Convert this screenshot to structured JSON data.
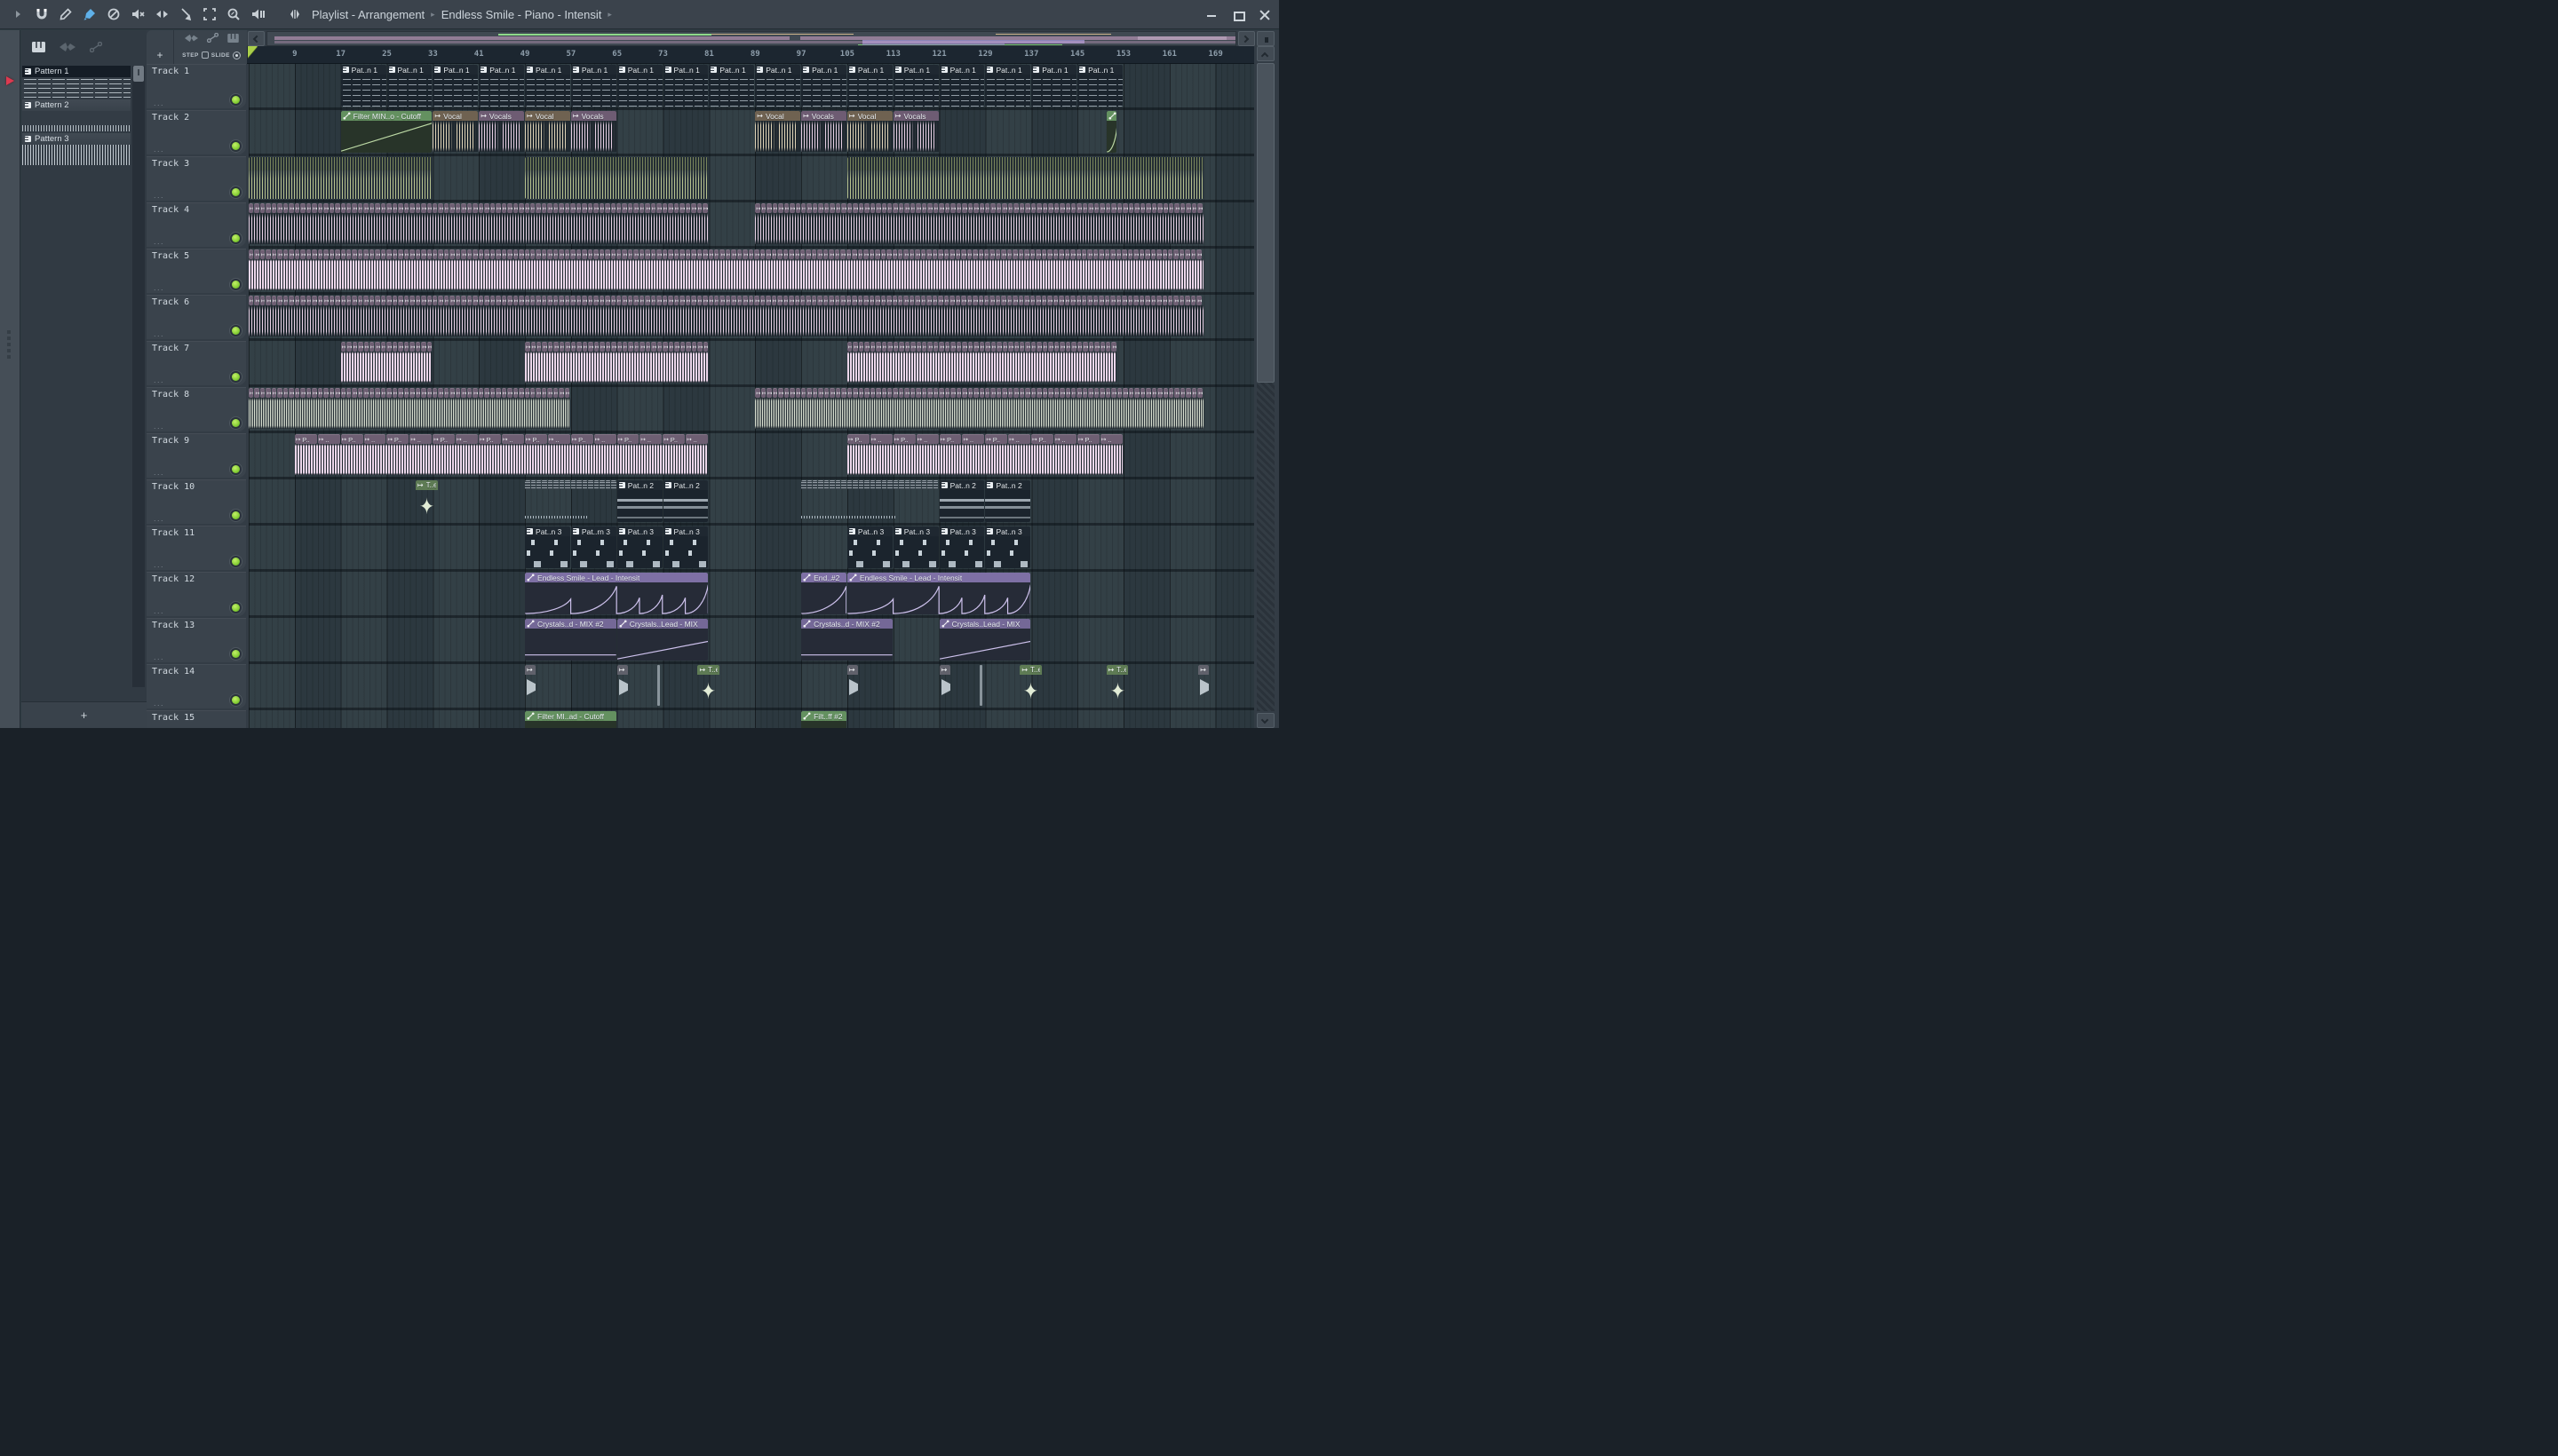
{
  "window": {
    "title_left": "Playlist - Arrangement",
    "title_right": "Endless Smile - Piano - Intensit",
    "chevron": "▸"
  },
  "toolbar_icons": [
    "play",
    "magnet",
    "pencil",
    "brush",
    "deny",
    "mute",
    "stretch",
    "slip",
    "select",
    "zoom",
    "preview-speaker"
  ],
  "window_controls": [
    "minimize",
    "maximize",
    "close"
  ],
  "picker": {
    "filter_icons": [
      "piano",
      "audio",
      "automation"
    ],
    "patterns": [
      {
        "name": "Pattern 1",
        "selected": true,
        "preview": "melody"
      },
      {
        "name": "Pattern 2",
        "selected": false,
        "preview": "dense"
      },
      {
        "name": "Pattern 3",
        "selected": false,
        "preview": "blocks"
      }
    ],
    "add_button": "+"
  },
  "playlist": {
    "add_track": "+",
    "step": "STEP",
    "slide": "SLIDE",
    "bar_width": 6.48,
    "ruler": [
      9,
      17,
      25,
      33,
      41,
      49,
      57,
      65,
      73,
      81,
      89,
      97,
      105,
      113,
      121,
      129,
      137,
      145,
      153,
      161,
      169
    ],
    "tracks": [
      {
        "name": "Track 1",
        "menu_dots": "...",
        "clips": [
          {
            "t": "pat",
            "l": "Pat..n 1",
            "s": 17,
            "e": 153,
            "rep": 8,
            "body": "notes"
          }
        ]
      },
      {
        "name": "Track 2",
        "menu_dots": "...",
        "clips": [
          {
            "t": "auto",
            "l": "Filter MIN..o - Cutoff",
            "s": 17,
            "e": 33,
            "c": "green",
            "body": "ramp"
          },
          {
            "t": "audio",
            "l": "Vocal",
            "s": 33,
            "e": 41,
            "c": "tan",
            "wave": "cream"
          },
          {
            "t": "audio",
            "l": "Vocals",
            "s": 41,
            "e": 49,
            "c": "plum",
            "wave": "pink"
          },
          {
            "t": "audio",
            "l": "Vocal",
            "s": 49,
            "e": 57,
            "c": "tan",
            "wave": "cream"
          },
          {
            "t": "audio",
            "l": "Vocals",
            "s": 57,
            "e": 65,
            "c": "plum",
            "wave": "pink"
          },
          {
            "t": "audio",
            "l": "Vocal",
            "s": 89,
            "e": 97,
            "c": "tan",
            "wave": "cream"
          },
          {
            "t": "audio",
            "l": "Vocals",
            "s": 97,
            "e": 105,
            "c": "plum",
            "wave": "pink"
          },
          {
            "t": "audio",
            "l": "Vocal",
            "s": 105,
            "e": 113,
            "c": "tan",
            "wave": "cream"
          },
          {
            "t": "audio",
            "l": "Vocals",
            "s": 113,
            "e": 121,
            "c": "plum",
            "wave": "pink"
          },
          {
            "t": "auto",
            "l": "",
            "s": 150,
            "e": 152,
            "c": "green",
            "body": "rise"
          }
        ]
      },
      {
        "name": "Track 3",
        "menu_dots": "...",
        "clips": [
          {
            "t": "stripes",
            "s": 1,
            "e": 33
          },
          {
            "t": "stripes",
            "s": 49,
            "e": 81
          },
          {
            "t": "stripes",
            "s": 105,
            "e": 137
          },
          {
            "t": "stripes",
            "s": 137,
            "e": 167
          }
        ]
      },
      {
        "name": "Track 4",
        "menu_dots": "...",
        "clips": [
          {
            "t": "units",
            "s": 1,
            "e": 81,
            "u": 1,
            "wave": "pinku"
          },
          {
            "t": "units",
            "s": 89,
            "e": 167,
            "u": 1,
            "wave": "pinku"
          }
        ]
      },
      {
        "name": "Track 5",
        "menu_dots": "...",
        "clips": [
          {
            "t": "units",
            "s": 1,
            "e": 167,
            "u": 1,
            "wave": "pinkfat"
          }
        ]
      },
      {
        "name": "Track 6",
        "menu_dots": "...",
        "clips": [
          {
            "t": "units",
            "s": 1,
            "e": 167,
            "u": 1,
            "wave": "pinku"
          }
        ]
      },
      {
        "name": "Track 7",
        "menu_dots": "...",
        "clips": [
          {
            "t": "units",
            "s": 17,
            "e": 33,
            "u": 1,
            "wave": "pinkfat"
          },
          {
            "t": "units",
            "s": 49,
            "e": 81,
            "u": 1,
            "wave": "pinkfat"
          },
          {
            "t": "units",
            "s": 105,
            "e": 152,
            "u": 1,
            "wave": "pinkfat"
          }
        ]
      },
      {
        "name": "Track 8",
        "menu_dots": "...",
        "clips": [
          {
            "t": "units",
            "s": 1,
            "e": 57,
            "u": 1,
            "wave": "greenu"
          },
          {
            "t": "units",
            "s": 89,
            "e": 167,
            "u": 1,
            "wave": "greenu"
          }
        ]
      },
      {
        "name": "Track 9",
        "menu_dots": "...",
        "clips": [
          {
            "t": "units",
            "s": 9,
            "e": 81,
            "u": 4,
            "wave": "pinkfat",
            "labels": [
              "P..",
              ".."
            ]
          },
          {
            "t": "units",
            "s": 105,
            "e": 153,
            "u": 4,
            "wave": "pinkfat",
            "labels": [
              "P..",
              ".."
            ]
          }
        ]
      },
      {
        "name": "Track 10",
        "menu_dots": "...",
        "clips": [
          {
            "t": "mini",
            "l": "T..e",
            "s": 30,
            "e": 34,
            "c": "green",
            "glyph": "star"
          },
          {
            "t": "patrow",
            "s": 49,
            "e": 65
          },
          {
            "t": "pat",
            "l": "Pat..n 2",
            "s": 65,
            "e": 73,
            "body": "notes2"
          },
          {
            "t": "pat",
            "l": "Pat..n 2",
            "s": 73,
            "e": 81,
            "body": "notes2"
          },
          {
            "t": "patrow",
            "s": 97,
            "e": 121
          },
          {
            "t": "pat",
            "l": "Pat..n 2",
            "s": 121,
            "e": 129,
            "body": "notes2"
          },
          {
            "t": "pat",
            "l": "Pat..n 2",
            "s": 129,
            "e": 137,
            "body": "notes2"
          }
        ]
      },
      {
        "name": "Track 11",
        "menu_dots": "...",
        "clips": [
          {
            "t": "pat",
            "l": "Pat..n 3",
            "s": 49,
            "e": 57,
            "body": "drums"
          },
          {
            "t": "pat",
            "l": "Pat..rn 3",
            "s": 57,
            "e": 65,
            "body": "drums"
          },
          {
            "t": "pat",
            "l": "Pat..n 3",
            "s": 65,
            "e": 73,
            "body": "drums"
          },
          {
            "t": "pat",
            "l": "Pat..n 3",
            "s": 73,
            "e": 81,
            "body": "drums"
          },
          {
            "t": "pat",
            "l": "Pat..n 3",
            "s": 105,
            "e": 113,
            "body": "drums"
          },
          {
            "t": "pat",
            "l": "Pat..n 3",
            "s": 113,
            "e": 121,
            "body": "drums"
          },
          {
            "t": "pat",
            "l": "Pat..n 3",
            "s": 121,
            "e": 129,
            "body": "drums"
          },
          {
            "t": "pat",
            "l": "Pat..n 3",
            "s": 129,
            "e": 137,
            "body": "drums"
          }
        ]
      },
      {
        "name": "Track 12",
        "menu_dots": "...",
        "clips": [
          {
            "t": "auto",
            "l": "Endless Smile - Lead - Intensit",
            "s": 49,
            "e": 81,
            "c": "purple",
            "body": "saw6"
          },
          {
            "t": "auto",
            "l": "End..#2",
            "s": 97,
            "e": 105,
            "c": "purple",
            "body": "saw1"
          },
          {
            "t": "auto",
            "l": "Endless Smile - Lead - Intensit",
            "s": 105,
            "e": 137,
            "c": "purple",
            "body": "saw6"
          }
        ]
      },
      {
        "name": "Track 13",
        "menu_dots": "...",
        "clips": [
          {
            "t": "auto",
            "l": "Crystals..d - MIX #2",
            "s": 49,
            "e": 65,
            "c": "purple2",
            "body": "flat"
          },
          {
            "t": "auto",
            "l": "Crystals..Lead - MIX",
            "s": 65,
            "e": 81,
            "c": "purple2",
            "body": "ramp60"
          },
          {
            "t": "auto",
            "l": "Crystals..d - MIX #2",
            "s": 97,
            "e": 113,
            "c": "purple2",
            "body": "flat"
          },
          {
            "t": "auto",
            "l": "Crystals..Lead - MIX",
            "s": 121,
            "e": 137,
            "c": "purple2",
            "body": "ramp60"
          }
        ]
      },
      {
        "name": "Track 14",
        "menu_dots": "...",
        "clips": [
          {
            "t": "mini",
            "l": "",
            "s": 49,
            "e": 51,
            "c": "gray",
            "glyph": "tri"
          },
          {
            "t": "mini",
            "l": "",
            "s": 65,
            "e": 67,
            "c": "gray",
            "glyph": "tri"
          },
          {
            "t": "mini",
            "l": "",
            "s": 72,
            "e": 72.5,
            "c": "gray",
            "glyph": "sliver"
          },
          {
            "t": "mini",
            "l": "T..e",
            "s": 79,
            "e": 83,
            "c": "green",
            "glyph": "star"
          },
          {
            "t": "mini",
            "l": "",
            "s": 105,
            "e": 107,
            "c": "gray",
            "glyph": "tri"
          },
          {
            "t": "mini",
            "l": "",
            "s": 121,
            "e": 123,
            "c": "gray",
            "glyph": "tri"
          },
          {
            "t": "mini",
            "l": "",
            "s": 128,
            "e": 128.5,
            "c": "gray",
            "glyph": "sliver"
          },
          {
            "t": "mini",
            "l": "T..e",
            "s": 135,
            "e": 139,
            "c": "green",
            "glyph": "star"
          },
          {
            "t": "mini",
            "l": "T..e",
            "s": 150,
            "e": 154,
            "c": "green",
            "glyph": "star"
          },
          {
            "t": "mini",
            "l": "",
            "s": 166,
            "e": 168,
            "c": "gray",
            "glyph": "tri"
          }
        ]
      },
      {
        "name": "Track 15",
        "menu_dots": "...",
        "clips": [
          {
            "t": "auto",
            "l": "Filter MI..ad - Cutoff",
            "s": 49,
            "e": 65,
            "c": "green",
            "body": "flat"
          },
          {
            "t": "auto",
            "l": "Filt..ff #2",
            "s": 97,
            "e": 105,
            "c": "green",
            "body": "flat"
          }
        ]
      }
    ]
  }
}
